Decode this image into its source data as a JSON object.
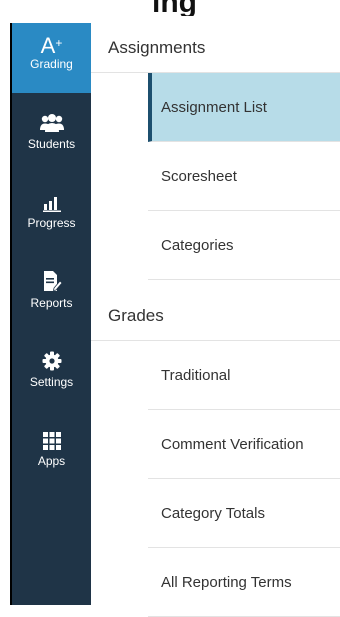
{
  "header": {
    "title": "ing"
  },
  "rail": {
    "items": [
      {
        "id": "grading",
        "label": "Grading",
        "icon": "a-plus-icon",
        "active": true
      },
      {
        "id": "students",
        "label": "Students",
        "icon": "students-icon",
        "active": false
      },
      {
        "id": "progress",
        "label": "Progress",
        "icon": "progress-chart-icon",
        "active": false
      },
      {
        "id": "reports",
        "label": "Reports",
        "icon": "report-edit-icon",
        "active": false
      },
      {
        "id": "settings",
        "label": "Settings",
        "icon": "gear-icon",
        "active": false
      },
      {
        "id": "apps",
        "label": "Apps",
        "icon": "apps-grid-icon",
        "active": false
      }
    ],
    "grading_icon_text": "A",
    "grading_icon_sup": "+"
  },
  "sections": [
    {
      "title": "Assignments",
      "items": [
        {
          "label": "Assignment List",
          "selected": true
        },
        {
          "label": "Scoresheet",
          "selected": false
        },
        {
          "label": "Categories",
          "selected": false
        }
      ]
    },
    {
      "title": "Grades",
      "items": [
        {
          "label": "Traditional",
          "selected": false
        },
        {
          "label": "Comment Verification",
          "selected": false
        },
        {
          "label": "Category Totals",
          "selected": false
        },
        {
          "label": "All Reporting Terms",
          "selected": false
        }
      ]
    }
  ],
  "colors": {
    "rail_bg": "#1f3447",
    "rail_active": "#2a8ac4",
    "selected_bg": "#b7dce8",
    "selected_bar": "#1c4f6e"
  }
}
